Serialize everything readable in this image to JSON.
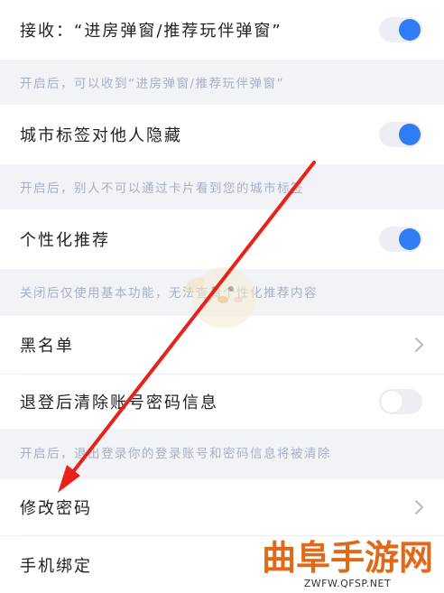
{
  "settings": {
    "room_popup": {
      "label": "接收：“进房弹窗/推荐玩伴弹窗”",
      "toggle": "on",
      "description": "开启后，可以收到“进房弹窗/推荐玩伴弹窗”"
    },
    "hide_city": {
      "label": "城市标签对他人隐藏",
      "toggle": "on",
      "description": "开启后，别人不可以通过卡片看到您的城市标签"
    },
    "personalized": {
      "label": "个性化推荐",
      "toggle": "on",
      "description": "关闭后仅使用基本功能，无法查看个性化推荐内容"
    },
    "blacklist": {
      "label": "黑名单"
    },
    "clear_on_logout": {
      "label": "退登后清除账号密码信息",
      "toggle": "off",
      "description": "开启后，退出登录你的登录账号和密码信息将被清除"
    },
    "change_password": {
      "label": "修改密码"
    },
    "phone_binding": {
      "label": "手机绑定"
    }
  },
  "colors": {
    "toggle_on": "#2f7cf6",
    "annotation_arrow": "#e8221b",
    "watermark_text": "#e06a1a"
  },
  "watermark": {
    "title": "曲阜手游网",
    "url": "ZWFW.QFSP.NET"
  }
}
